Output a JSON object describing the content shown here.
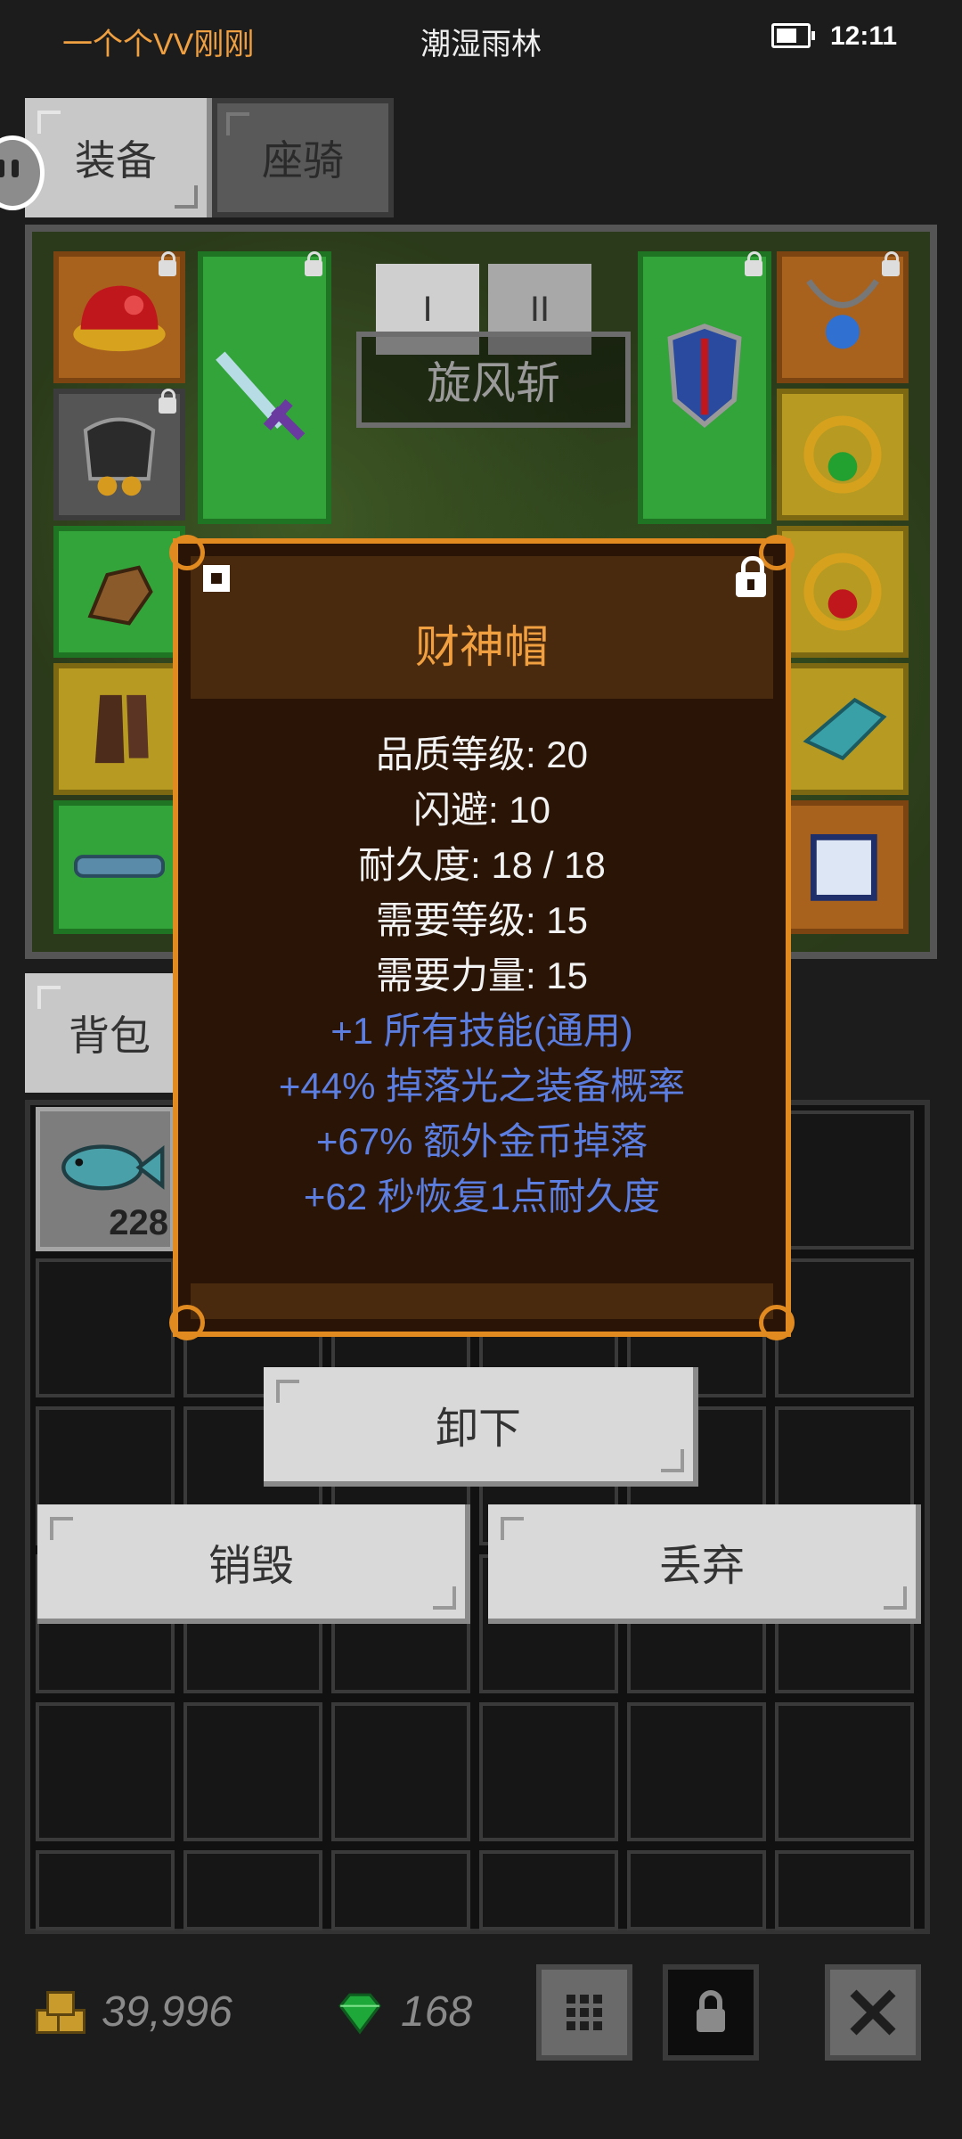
{
  "status_bar": {
    "left_text": "一个个VV刚刚",
    "center_text": "潮湿雨林",
    "time": "12:11"
  },
  "tabs": {
    "equipment": "装备",
    "mount": "座骑"
  },
  "skill": {
    "tab_1": "I",
    "tab_2": "II",
    "name": "旋风斩"
  },
  "backpack": {
    "tab_label": "背包",
    "fish_count": "228"
  },
  "item_tooltip": {
    "name": "财神帽",
    "stats": [
      "品质等级: 20",
      "闪避: 10",
      "耐久度: 18 / 18",
      "需要等级: 15",
      "需要力量: 15"
    ],
    "affixes": [
      "+1 所有技能(通用)",
      "+44% 掉落光之装备概率",
      "+67% 额外金币掉落",
      "+62 秒恢复1点耐久度"
    ]
  },
  "actions": {
    "unequip": "卸下",
    "destroy": "销毁",
    "discard": "丢弃"
  },
  "currency": {
    "gold": "39,996",
    "gems": "168"
  },
  "colors": {
    "title_orange": "#f0a040",
    "affix_blue": "#5b7ee0",
    "tooltip_border": "#e08a20"
  }
}
